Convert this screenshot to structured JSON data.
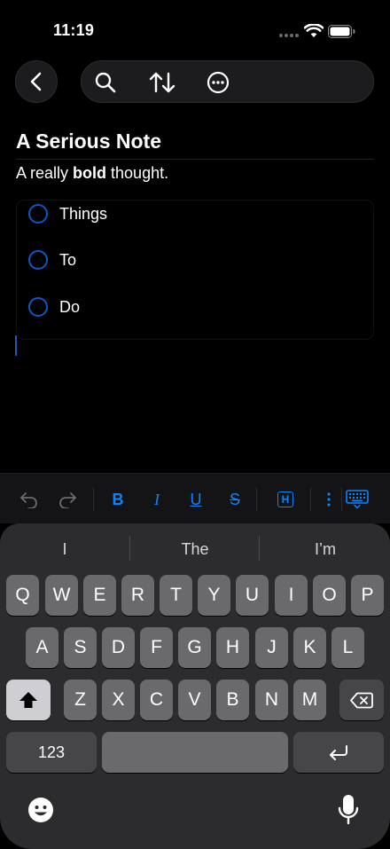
{
  "status_bar": {
    "time": "11:19"
  },
  "nav": {
    "back_icon": "chevron-left-icon",
    "tools": [
      "search-icon",
      "sort-arrows-icon",
      "more-ellipsis-icon"
    ]
  },
  "note": {
    "title": "A Serious Note",
    "paragraph": {
      "before": "A really ",
      "bold": "bold",
      "after": " thought."
    },
    "todos": [
      {
        "label": "Things",
        "checked": false
      },
      {
        "label": "To",
        "checked": false
      },
      {
        "label": "Do",
        "checked": false
      }
    ]
  },
  "format_toolbar": {
    "bold": "B",
    "italic": "I",
    "underline": "U",
    "strike": "S",
    "heading": "H",
    "icons": [
      "undo-icon",
      "redo-icon",
      "more-vertical-icon",
      "keyboard-dismiss-icon"
    ],
    "accent_color": "#0a84ff"
  },
  "keyboard": {
    "suggestions": [
      "I",
      "The",
      "I’m"
    ],
    "row1": [
      "Q",
      "W",
      "E",
      "R",
      "T",
      "Y",
      "U",
      "I",
      "O",
      "P"
    ],
    "row2": [
      "A",
      "S",
      "D",
      "F",
      "G",
      "H",
      "J",
      "K",
      "L"
    ],
    "row3": [
      "Z",
      "X",
      "C",
      "V",
      "B",
      "N",
      "M"
    ],
    "numbers_key": "123",
    "space_key": "",
    "icons": [
      "shift-icon",
      "backspace-icon",
      "return-icon",
      "emoji-icon",
      "microphone-icon"
    ]
  }
}
